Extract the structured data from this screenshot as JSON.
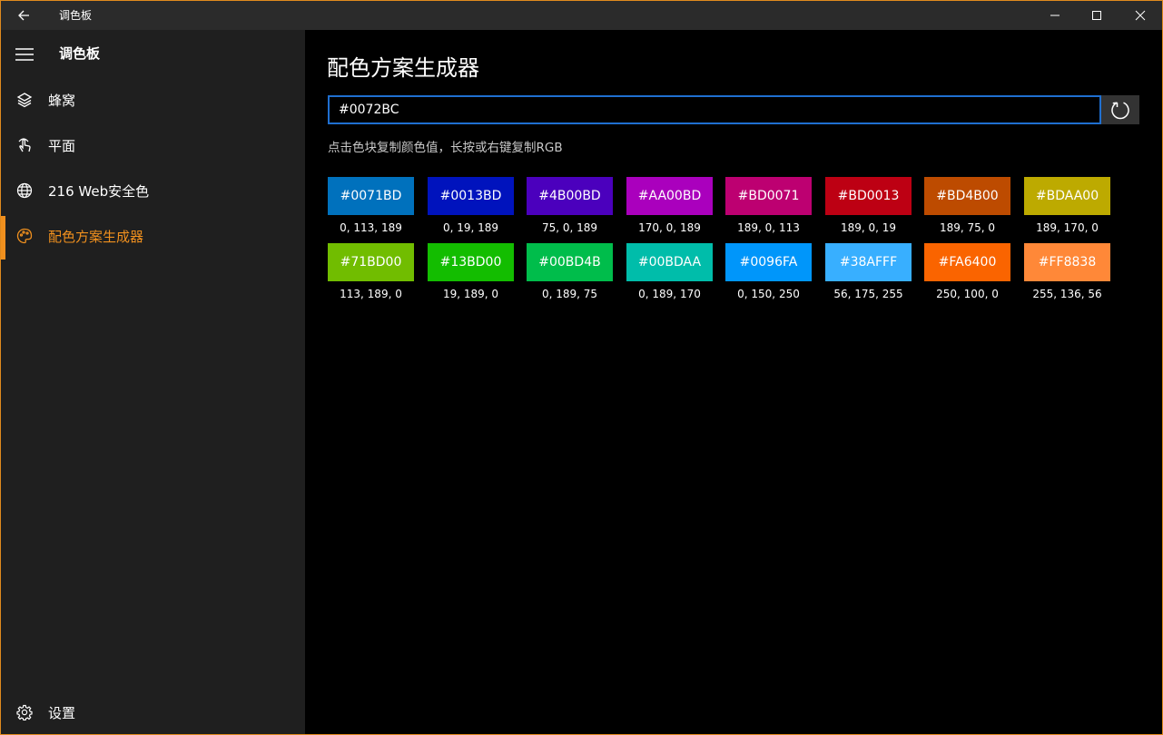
{
  "window": {
    "title": "调色板"
  },
  "sidebar": {
    "title": "调色板",
    "items": [
      {
        "label": "蜂窝",
        "icon": "layers-icon"
      },
      {
        "label": "平面",
        "icon": "touch-hand-icon"
      },
      {
        "label": "216 Web安全色",
        "icon": "globe-icon"
      },
      {
        "label": "配色方案生成器",
        "icon": "palette-icon",
        "active": true
      }
    ],
    "settings_label": "设置"
  },
  "main": {
    "title": "配色方案生成器",
    "input_value": "#0072BC",
    "hint": "点击色块复制颜色值，长按或右键复制RGB",
    "swatches": [
      {
        "hex": "#0071BD",
        "rgb": "0, 113, 189",
        "color": "#0071BD"
      },
      {
        "hex": "#0013BD",
        "rgb": "0, 19, 189",
        "color": "#0013BD"
      },
      {
        "hex": "#4B00BD",
        "rgb": "75, 0, 189",
        "color": "#4B00BD"
      },
      {
        "hex": "#AA00BD",
        "rgb": "170, 0, 189",
        "color": "#AA00BD"
      },
      {
        "hex": "#BD0071",
        "rgb": "189, 0, 113",
        "color": "#BD0071"
      },
      {
        "hex": "#BD0013",
        "rgb": "189, 0, 19",
        "color": "#BD0013"
      },
      {
        "hex": "#BD4B00",
        "rgb": "189, 75, 0",
        "color": "#BD4B00"
      },
      {
        "hex": "#BDAA00",
        "rgb": "189, 170, 0",
        "color": "#BDAA00"
      },
      {
        "hex": "#71BD00",
        "rgb": "113, 189, 0",
        "color": "#71BD00"
      },
      {
        "hex": "#13BD00",
        "rgb": "19, 189, 0",
        "color": "#13BD00"
      },
      {
        "hex": "#00BD4B",
        "rgb": "0, 189, 75",
        "color": "#00BD4B"
      },
      {
        "hex": "#00BDAA",
        "rgb": "0, 189, 170",
        "color": "#00BDAA"
      },
      {
        "hex": "#0096FA",
        "rgb": "0, 150, 250",
        "color": "#0096FA"
      },
      {
        "hex": "#38AFFF",
        "rgb": "56, 175, 255",
        "color": "#38AFFF"
      },
      {
        "hex": "#FA6400",
        "rgb": "250, 100, 0",
        "color": "#FA6400"
      },
      {
        "hex": "#FF8838",
        "rgb": "255, 136, 56",
        "color": "#FF8838"
      }
    ]
  },
  "colors": {
    "accent": "#F0901E",
    "input_border": "#1F6FD0"
  }
}
